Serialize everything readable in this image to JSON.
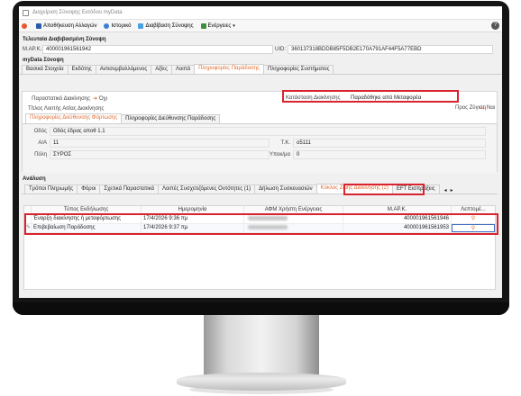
{
  "window": {
    "title": "Διαχείριση Σύνοψης Εισόδου myData"
  },
  "toolbar": {
    "save": "Αποθήκευση Αλλαγών",
    "history": "Ιστορικό",
    "read_summary": "Διαβίβαση Σύνοψης",
    "actions": "Ενέργειες",
    "help": "?"
  },
  "received": {
    "title": "Τελευταία Διαβιβασμένη Σύνοψη",
    "mark_label": "Μ.ΑΡ.Κ.:",
    "mark_value": "400001961561942",
    "uid_label": "UID:",
    "uid_value": "360137318BDDB85F5DB2E170A791AF44F5A77EBD"
  },
  "mydata": {
    "title": "myData Σύνοψη",
    "tabs": [
      "Βασικά Στοιχεία",
      "Εκδότης",
      "Αντισυμβαλλόμενος",
      "Αξίες",
      "Λοιπά",
      "Πληροφορίες Παράδοσης",
      "Πληροφορίες Συστήματος"
    ],
    "active_tab": 5,
    "delivery_note_label": "Παραστατικό Διακίνησης",
    "delivery_note_value": "Όχι",
    "movement_status_label": "Κατάσταση Διακίνησης",
    "movement_status_value": "Παραδόθηκε από Μεταφορέα",
    "other_reason_label": "Τίτλος Λοιπής Αιτίας Διακίνησης",
    "weighing_label": "Προς Ζύγιση",
    "weighing_value": "Ναι",
    "subtabs": [
      "Πληροφορίες Διεύθυνσης Φόρτωσης",
      "Πληροφορίες Διεύθυνσης Παράδοσης"
    ],
    "street_label": "Οδός",
    "street_value": "Οδός έδρας αποθ 1.1",
    "number_label": "Α/Α",
    "number_value": "11",
    "postal_label": "Τ.Κ.",
    "postal_value": "o5111",
    "city_label": "Πόλη",
    "city_value": "ΣΥΡΟΣ",
    "floor_label": "Υποκ/μα",
    "floor_value": "0"
  },
  "analysis": {
    "title": "Ανάλυση",
    "tabs": [
      "Τρόποι Πληρωμής",
      "Φόροι",
      "Σχετικά Παραστατικά",
      "Λοιπές Συσχετιζόμενες Οντότητες (1)",
      "Δήλωση Συσκευασιών",
      "Κύκλος Ζωής Διακίνησης (2)",
      "EFT Εισπράξεις"
    ],
    "active_tab": 5,
    "columns": [
      "Τύπος Εκδήλωσης",
      "Ημερομηνία",
      "ΑΦΜ Χρήστη Ενέργειας",
      "Μ.ΑΡ.Κ.",
      "Λεπτομέ..."
    ],
    "rows": [
      {
        "type": "Έναρξη διακίνησης ή μεταφόρτωσης",
        "date": "17/4/2026 9:36 πμ",
        "mark": "400001961561946"
      },
      {
        "type": "Επιβεβαίωση Παράδοσης",
        "date": "17/4/2026 9:37 πμ",
        "mark": "400001961561953"
      }
    ]
  }
}
